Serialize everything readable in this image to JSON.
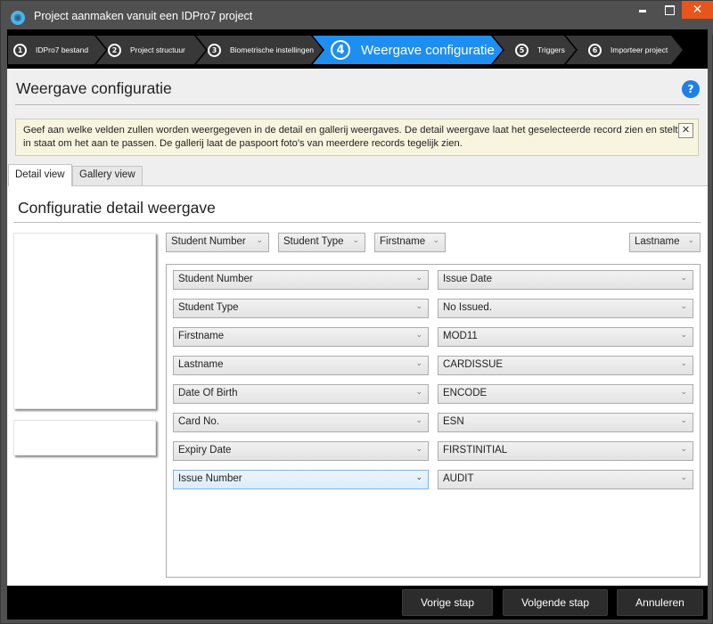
{
  "window": {
    "title": "Project aanmaken vanuit een IDPro7 project",
    "icon": "app-logo-icon",
    "controls": {
      "minimize": "minimize-icon",
      "maximize": "maximize-icon",
      "close": "✕"
    }
  },
  "wizard": {
    "steps": [
      {
        "number": "1",
        "label": "IDPro7 bestand",
        "active": false
      },
      {
        "number": "2",
        "label": "Project structuur",
        "active": false
      },
      {
        "number": "3",
        "label": "Biometrische instellingen",
        "active": false
      },
      {
        "number": "4",
        "label": "Weergave configuratie",
        "active": true
      },
      {
        "number": "5",
        "label": "Triggers",
        "active": false
      },
      {
        "number": "6",
        "label": "Importeer project",
        "active": false
      }
    ]
  },
  "page": {
    "title": "Weergave configuratie",
    "help": "?",
    "info_text": "Geef aan welke velden zullen worden weergegeven in de detail en gallerij weergaves. De detail weergave laat het geselecteerde record zien en stelt u in staat om het aan te passen. De gallerij laat de paspoort foto's van meerdere records tegelijk zien.",
    "info_close": "✕"
  },
  "tabs": [
    {
      "label": "Detail view",
      "active": true
    },
    {
      "label": "Gallery view",
      "active": false
    }
  ],
  "detail": {
    "section_title": "Configuratie detail weergave",
    "header_fields": [
      "Student Number",
      "Student Type",
      "Firstname",
      "Lastname"
    ],
    "left_fields": [
      "Student Number",
      "Student Type",
      "Firstname",
      "Lastname",
      "Date Of Birth",
      "Card No.",
      "Expiry Date",
      "Issue Number"
    ],
    "right_fields": [
      "Issue Date",
      "No Issued.",
      "MOD11",
      "CARDISSUE",
      "ENCODE",
      "ESN",
      "FIRSTINITIAL",
      "AUDIT"
    ],
    "focused_field": "Issue Number",
    "chevron": "⌄"
  },
  "footer": {
    "previous": "Vorige stap",
    "next": "Volgende stap",
    "cancel": "Annuleren"
  }
}
